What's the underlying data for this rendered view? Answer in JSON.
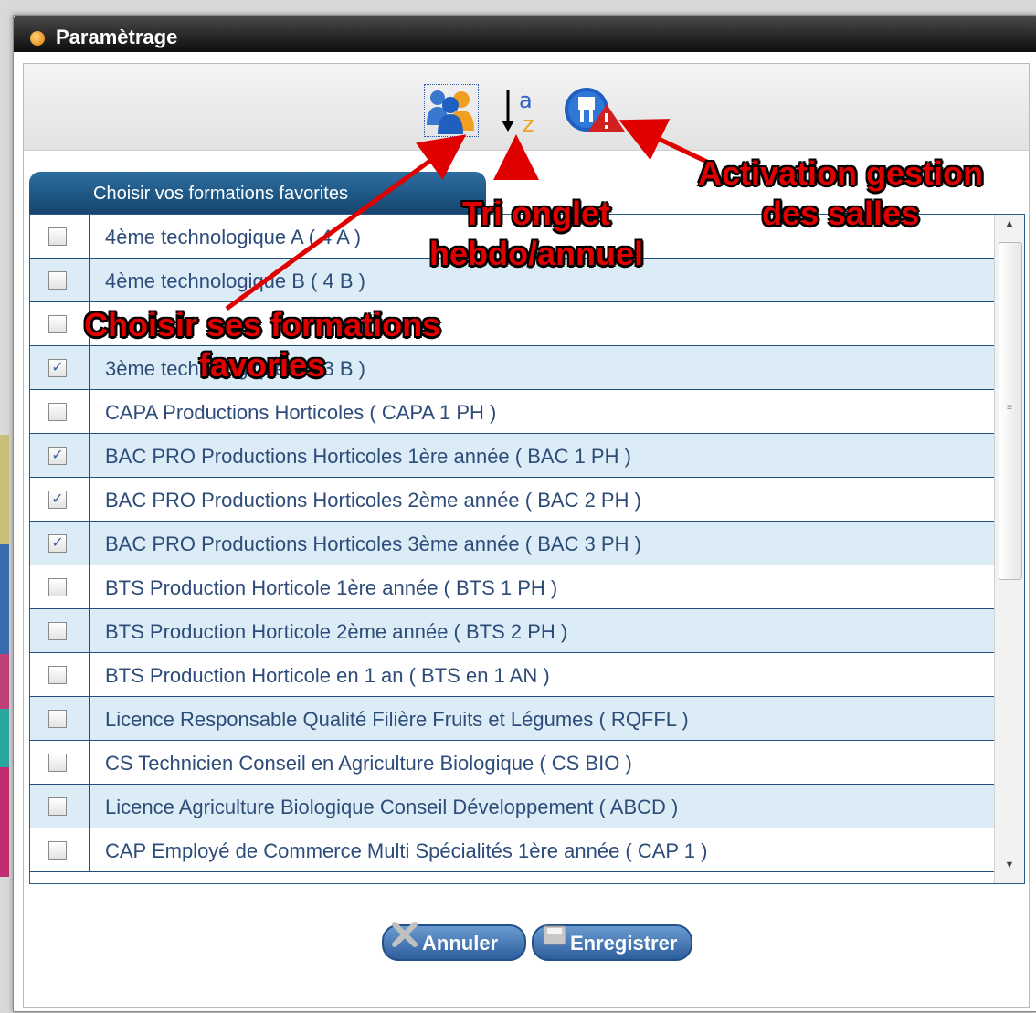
{
  "window": {
    "title": "Paramètrage"
  },
  "toolbar": {
    "favorites_icon": "users-group-icon",
    "sort_icon": "sort-az-icon",
    "rooms_icon": "room-warning-icon"
  },
  "tab": {
    "label": "Choisir vos formations favorites"
  },
  "formations": [
    {
      "label": "4ème technologique A ( 4 A )",
      "checked": false
    },
    {
      "label": "4ème technologique B ( 4 B )",
      "checked": false
    },
    {
      "label": "",
      "checked": false
    },
    {
      "label": "3ème technologique B ( 3 B )",
      "checked": true
    },
    {
      "label": "CAPA Productions Horticoles ( CAPA 1 PH )",
      "checked": false
    },
    {
      "label": "BAC PRO Productions Horticoles 1ère année ( BAC 1 PH )",
      "checked": true
    },
    {
      "label": "BAC PRO Productions Horticoles 2ème année ( BAC 2 PH )",
      "checked": true
    },
    {
      "label": "BAC PRO Productions Horticoles 3ème année ( BAC 3 PH )",
      "checked": true
    },
    {
      "label": "BTS Production Horticole 1ère année ( BTS 1 PH )",
      "checked": false
    },
    {
      "label": "BTS Production Horticole 2ème année ( BTS 2 PH )",
      "checked": false
    },
    {
      "label": "BTS Production Horticole en 1 an ( BTS en 1 AN )",
      "checked": false
    },
    {
      "label": "Licence Responsable Qualité Filière Fruits et Légumes ( RQFFL )",
      "checked": false
    },
    {
      "label": "CS Technicien Conseil en Agriculture Biologique ( CS BIO )",
      "checked": false
    },
    {
      "label": "Licence Agriculture Biologique Conseil Développement ( ABCD )",
      "checked": false
    },
    {
      "label": "CAP Employé de Commerce Multi Spécialités 1ère année ( CAP 1 )",
      "checked": false
    }
  ],
  "buttons": {
    "cancel": "Annuler",
    "save": "Enregistrer"
  },
  "annotations": {
    "rooms_line1": "Activation gestion",
    "rooms_line2": "des salles",
    "sort_line1": "Tri onglet",
    "sort_line2": "hebdo/annuel",
    "fav_line1": "Choisir ses formations",
    "fav_line2": "favories"
  },
  "colors": {
    "annotation": "#e00000",
    "header": "#1f4f7a",
    "row_alt": "#dcecf6",
    "text": "#2d4c7a"
  }
}
